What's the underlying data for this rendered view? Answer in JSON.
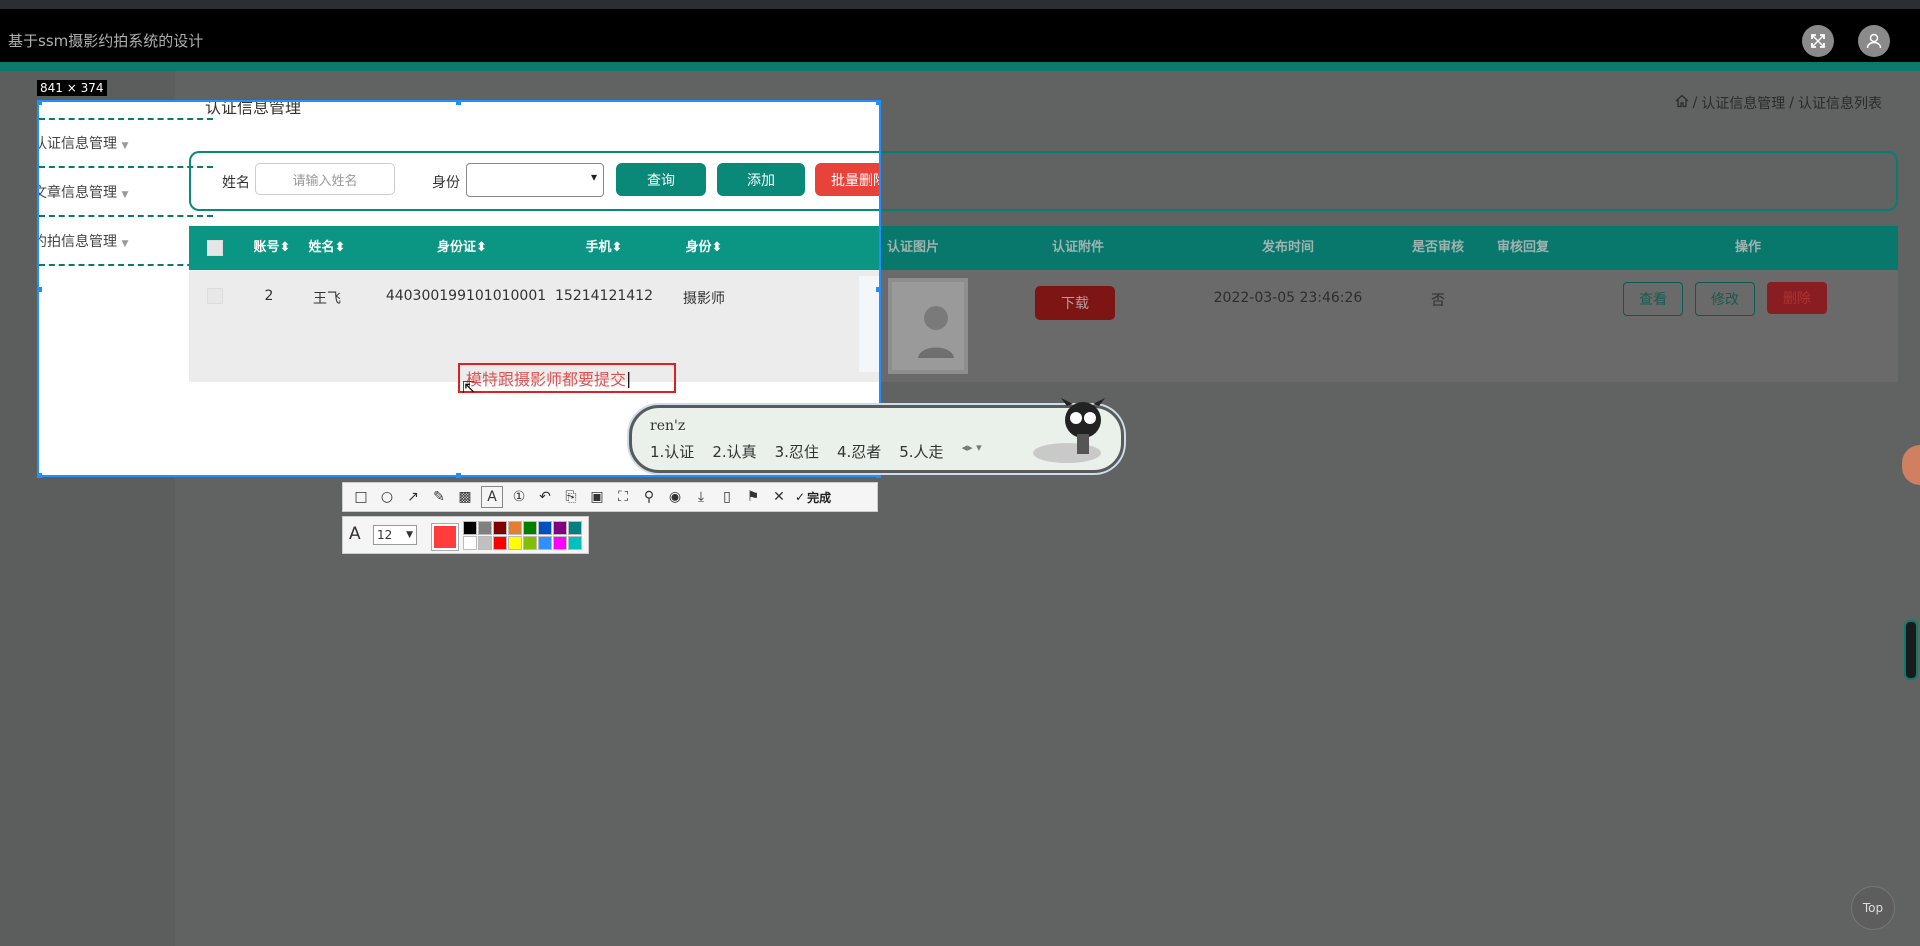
{
  "app": {
    "title": "基于ssm摄影约拍系统的设计"
  },
  "header": {
    "fullscreen_icon": "fullscreen-icon",
    "user_icon": "user-icon"
  },
  "breadcrumb": {
    "home_icon": "home-icon",
    "items": [
      "认证信息管理",
      "认证信息列表"
    ],
    "separator": "/"
  },
  "sidebar": {
    "items": [
      {
        "label": "认证信息管理"
      },
      {
        "label": "文章信息管理"
      },
      {
        "label": "约拍信息管理"
      }
    ]
  },
  "page": {
    "title": "认证信息管理"
  },
  "search": {
    "name_label": "姓名",
    "name_placeholder": "请输入姓名",
    "role_label": "身份",
    "role_value": "",
    "query_button": "查询",
    "add_button": "添加",
    "batch_delete_button": "批量删除"
  },
  "table": {
    "columns": [
      "账号",
      "姓名",
      "身份证",
      "手机",
      "身份",
      "认证图片",
      "认证附件",
      "发布时间",
      "是否审核",
      "审核回复",
      "操作"
    ],
    "rows": [
      {
        "account": "2",
        "name": "王飞",
        "id_card": "440300199101010001",
        "phone": "15214121412",
        "role": "摄影师",
        "download": "下载",
        "time": "2022-03-05 23:46:26",
        "audited": "否",
        "reply": "",
        "view": "查看",
        "edit": "修改",
        "delete": "删除"
      }
    ]
  },
  "screenshot_tool": {
    "size_label": "841 × 374",
    "annotation_text": "模特跟摄影师都要提交",
    "font_size": "12",
    "current_color": "#ff3b3b",
    "done_label": "完成",
    "palette": [
      "#000000",
      "#808080",
      "#800000",
      "#e08030",
      "#008000",
      "#0050c0",
      "#800080",
      "#008080",
      "#ffffff",
      "#c0c0c0",
      "#ff0000",
      "#ffff00",
      "#80c000",
      "#3090ff",
      "#ff00ff",
      "#00c0c0"
    ]
  },
  "ime": {
    "pinyin": "ren'z",
    "candidates": [
      "1.认证",
      "2.认真",
      "3.忍住",
      "4.忍者",
      "5.人走"
    ]
  },
  "back_to_top": "Top"
}
